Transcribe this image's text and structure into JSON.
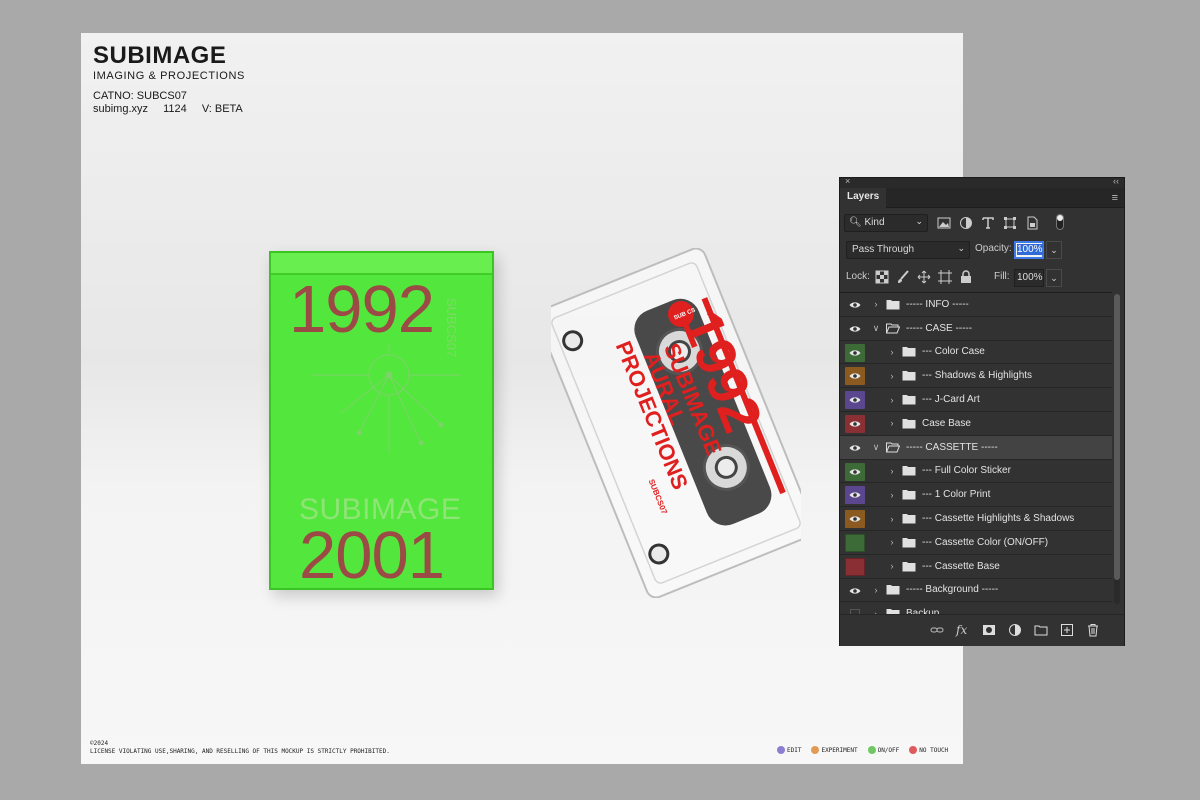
{
  "sheet": {
    "brand_title": "SUBIMAGE",
    "brand_sub": "IMAGING & PROJECTIONS",
    "catno": "CATNO: SUBCS07",
    "site": "subimg.xyz",
    "number": "1124",
    "version": "V: BETA",
    "copyright_year": "©2024",
    "license": "LICENSE VIOLATING USE,SHARING, AND RESELLING OF THIS MOCKUP IS STRICTLY PROHIBITED.",
    "legend": [
      {
        "label": "EDIT",
        "color": "#8a7fd0"
      },
      {
        "label": "EXPERIMENT",
        "color": "#e29a57"
      },
      {
        "label": "ON/OFF",
        "color": "#72c765"
      },
      {
        "label": "NO TOUCH",
        "color": "#df5a5a"
      }
    ]
  },
  "green_case": {
    "year_top": "1992",
    "year_bottom": "2001",
    "brand": "SUBIMAGE",
    "spine_text": "SUBCS07",
    "color": "#53e63c"
  },
  "cassette": {
    "year": "1992",
    "line1": "SUBIMAGE",
    "line2": "AURAL",
    "line3": "PROJECTIONS",
    "catno": "SUBCS07",
    "label_logo": "SUB CS",
    "accent": "#e01f1f"
  },
  "layers_panel": {
    "title": "Layers",
    "close_icon": "×",
    "collapse_icon": "‹‹",
    "menu_icon": "≡",
    "filter_kind": "Kind",
    "blend_mode": "Pass Through",
    "opacity_label": "Opacity:",
    "opacity_value": "100%",
    "lock_label": "Lock:",
    "fill_label": "Fill:",
    "fill_value": "100%",
    "layers": [
      {
        "name": "----- INFO -----",
        "indent": 0,
        "expanded": false,
        "visible": true,
        "tag": "none"
      },
      {
        "name": "----- CASE -----",
        "indent": 0,
        "expanded": true,
        "visible": true,
        "tag": "none"
      },
      {
        "name": "--- Color Case",
        "indent": 1,
        "expanded": false,
        "visible": true,
        "tag": "green"
      },
      {
        "name": "--- Shadows & Highlights",
        "indent": 1,
        "expanded": false,
        "visible": true,
        "tag": "orange"
      },
      {
        "name": "--- J-Card Art",
        "indent": 1,
        "expanded": false,
        "visible": true,
        "tag": "violet"
      },
      {
        "name": "Case Base",
        "indent": 1,
        "expanded": false,
        "visible": true,
        "tag": "red"
      },
      {
        "name": "----- CASSETTE -----",
        "indent": 0,
        "expanded": true,
        "visible": true,
        "tag": "none",
        "selected": true
      },
      {
        "name": "--- Full Color Sticker",
        "indent": 1,
        "expanded": false,
        "visible": true,
        "tag": "green"
      },
      {
        "name": "--- 1 Color Print",
        "indent": 1,
        "expanded": false,
        "visible": true,
        "tag": "violet"
      },
      {
        "name": "--- Cassette Highlights & Shadows",
        "indent": 1,
        "expanded": false,
        "visible": true,
        "tag": "orange"
      },
      {
        "name": "--- Cassette Color (ON/OFF)",
        "indent": 1,
        "expanded": false,
        "visible": false,
        "tag": "green"
      },
      {
        "name": "--- Cassette Base",
        "indent": 1,
        "expanded": false,
        "visible": false,
        "tag": "red"
      },
      {
        "name": "----- Background -----",
        "indent": 0,
        "expanded": false,
        "visible": true,
        "tag": "none"
      },
      {
        "name": "Backup",
        "indent": 0,
        "expanded": false,
        "visible": false,
        "tag": "none"
      }
    ],
    "tag_colors": {
      "green": "#3d6b37",
      "orange": "#8a5a21",
      "violet": "#5b478f",
      "red": "#8a2f34",
      "none": "transparent"
    },
    "bottom_icons": [
      "link-icon",
      "fx-icon",
      "mask-icon",
      "adjustment-icon",
      "folder-icon",
      "new-layer-icon",
      "trash-icon"
    ],
    "fx_label": "fx"
  }
}
